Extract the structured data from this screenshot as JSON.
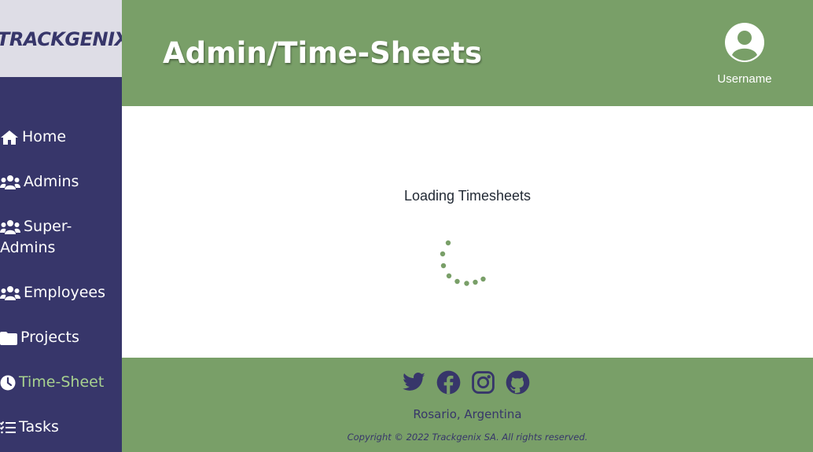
{
  "app": {
    "logo": "TRACKGENIX"
  },
  "sidebar": {
    "items": [
      {
        "label": "Home",
        "icon": "home-icon",
        "active": false
      },
      {
        "label": "Admins",
        "icon": "users-icon",
        "active": false
      },
      {
        "label": "Super-\nAdmins",
        "icon": "users-icon",
        "active": false
      },
      {
        "label": "Employees",
        "icon": "users-icon",
        "active": false
      },
      {
        "label": "Projects",
        "icon": "folder-icon",
        "active": false
      },
      {
        "label": "Time-Sheet",
        "icon": "clock-icon",
        "active": true
      },
      {
        "label": "Tasks",
        "icon": "tasks-icon",
        "active": false
      }
    ]
  },
  "header": {
    "title": "Admin/Time-Sheets",
    "username": "Username",
    "avatar_icon": "user-circle-icon"
  },
  "main": {
    "loading_text": "Loading Timesheets",
    "spinner_icon": "loading-spinner-icon"
  },
  "footer": {
    "social": [
      "twitter-icon",
      "facebook-icon",
      "instagram-icon",
      "github-icon"
    ],
    "location": "Rosario, Argentina",
    "copyright": "Copyright © 2022 Trackgenix SA. All rights reserved."
  },
  "colors": {
    "sidebar": "#37366a",
    "header": "#799f68",
    "logo_bg": "#dedde6",
    "active": "#a8d28f",
    "text_dark": "#37366a"
  }
}
